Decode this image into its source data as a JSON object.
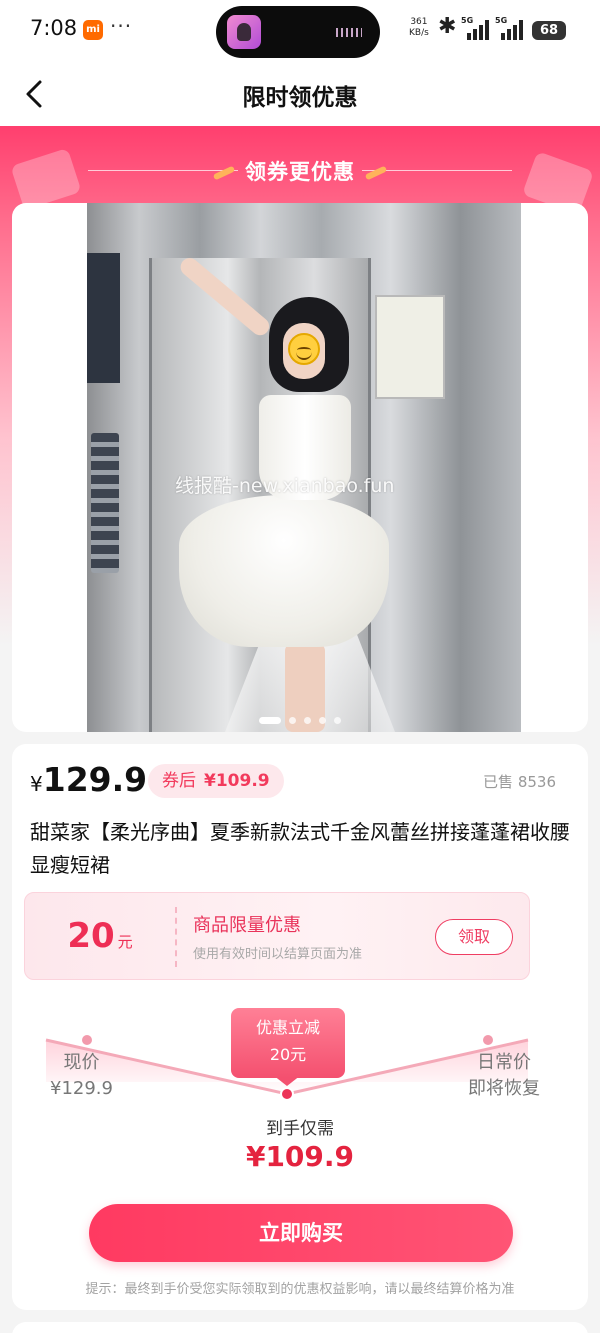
{
  "status_bar": {
    "time": "7:08",
    "carrier_badge": "mi",
    "more": "···",
    "net_speed_value": "361",
    "net_speed_unit": "KB/s",
    "sim1_label": "5G",
    "sim2_label": "5G",
    "battery": "68"
  },
  "nav": {
    "title": "限时领优惠",
    "back_icon": "chevron-left-icon"
  },
  "banner": {
    "heading": "领券更优惠"
  },
  "product_image": {
    "watermark": "线报酷-new.xianbao.fun",
    "pages": 5,
    "active_page": 1
  },
  "price": {
    "currency": "¥",
    "current": "129.9",
    "coupon_label": "券后",
    "after_coupon": "¥109.9",
    "sold": "已售 8536"
  },
  "product": {
    "title": "甜菜家【柔光序曲】夏季新款法式千金风蕾丝拼接蓬蓬裙收腰显瘦短裙"
  },
  "coupon": {
    "amount": "20",
    "unit": "元",
    "name": "商品限量优惠",
    "description": "使用有效时间以结算页面为准",
    "claim_label": "领取"
  },
  "price_flow": {
    "left_label": "现价",
    "left_value": "¥129.9",
    "cut_label": "优惠立减",
    "cut_value": "20元",
    "right_label": "日常价",
    "right_value": "即将恢复",
    "final_label": "到手仅需",
    "final_price": "¥109.9"
  },
  "actions": {
    "buy_label": "立即购买"
  },
  "tip": "提示：最终到手价受您实际领取到的优惠权益影响，请以最终结算价格为准",
  "colors": {
    "accent": "#f23a5c",
    "banner_top": "#ff3f6e",
    "price_red": "#e4233f"
  }
}
